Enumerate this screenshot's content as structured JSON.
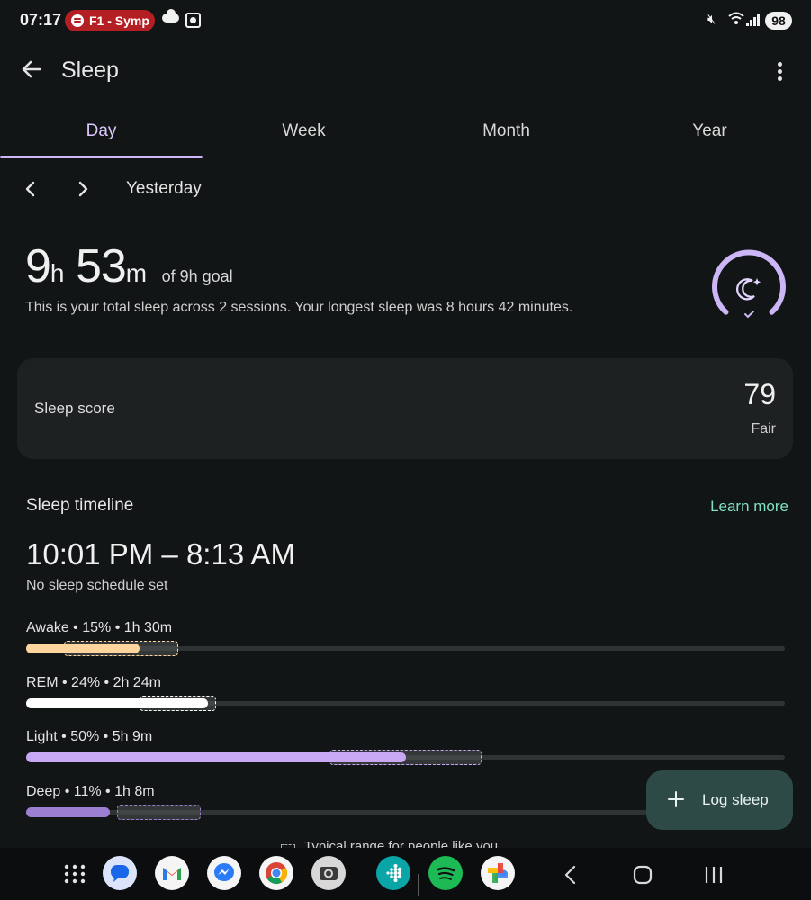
{
  "status_bar": {
    "time": "07:17",
    "media_label": "F1 - Symp",
    "battery": "98"
  },
  "app_bar": {
    "title": "Sleep"
  },
  "tabs": [
    "Day",
    "Week",
    "Month",
    "Year"
  ],
  "active_tab": "Day",
  "date_nav": {
    "label": "Yesterday"
  },
  "summary": {
    "hours": "9",
    "hours_unit": "h",
    "minutes": "53",
    "minutes_unit": "m",
    "goal_text": "of 9h goal",
    "description": "This is your total sleep across 2 sessions. Your longest sleep was 8 hours 42 minutes."
  },
  "score_card": {
    "label": "Sleep score",
    "value": "79",
    "rating": "Fair"
  },
  "timeline": {
    "title": "Sleep timeline",
    "learn_more": "Learn more",
    "time_range": "10:01 PM – 8:13 AM",
    "schedule_note": "No sleep schedule set",
    "stages": [
      {
        "label": "Awake • 15% • 1h 30m",
        "percent": 15,
        "typical_range": [
          5,
          20
        ],
        "color": "#ffd59e"
      },
      {
        "label": "REM • 24% • 2h 24m",
        "percent": 24,
        "typical_range": [
          15,
          25
        ],
        "color": "#ffffff"
      },
      {
        "label": "Light • 50% • 5h 9m",
        "percent": 50,
        "typical_range": [
          40,
          60
        ],
        "color": "#c8a8f2"
      },
      {
        "label": "Deep • 11% • 1h 8m",
        "percent": 11,
        "typical_range": [
          12,
          23
        ],
        "color": "#9b7fd0"
      }
    ],
    "legend": "Typical range for people like you"
  },
  "fab": {
    "label": "Log sleep"
  },
  "dock_icons": [
    "apps-grid-icon",
    "messages-icon",
    "gmail-icon",
    "messenger-icon",
    "chrome-icon",
    "camera-icon",
    "fitbit-icon",
    "spotify-icon",
    "photos-icon"
  ],
  "colors": {
    "accent": "#cdb6f6",
    "link": "#7fe0c4",
    "background": "#111516",
    "card": "#1d2122",
    "fab": "#2d4a47"
  }
}
